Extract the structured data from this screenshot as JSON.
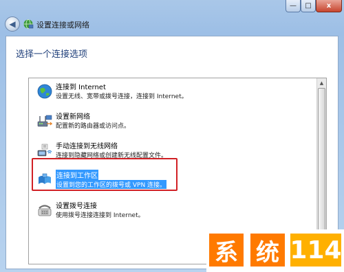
{
  "window": {
    "title": "设置连接或网络",
    "controls": {
      "minimize": "—",
      "maximize": "□",
      "close": "x"
    },
    "back_glyph": "◀"
  },
  "page": {
    "heading": "选择一个连接选项"
  },
  "options": [
    {
      "title": "连接到 Internet",
      "desc": "设置无线、宽带或拨号连接，连接到 Internet。",
      "icon": "globe-internet-icon",
      "selected": false
    },
    {
      "title": "设置新网络",
      "desc": "配置新的路由器或访问点。",
      "icon": "network-router-icon",
      "selected": false
    },
    {
      "title": "手动连接到无线网络",
      "desc": "连接到隐藏网络或创建新无线配置文件。",
      "icon": "wireless-network-icon",
      "selected": false
    },
    {
      "title": "连接到工作区",
      "desc": "设置到您的工作区的拨号或 VPN 连接。",
      "icon": "workplace-vpn-icon",
      "selected": true
    },
    {
      "title": "设置拨号连接",
      "desc": "使用拨号连接连接到 Internet。",
      "icon": "dialup-phone-icon",
      "selected": false
    }
  ],
  "watermark": {
    "part1": "系",
    "part2": "统",
    "part3": "114",
    "colors": {
      "orange": "#ff7a00",
      "yellow": "#ffb000"
    }
  },
  "colors": {
    "selection": "#3399ff",
    "annotation_box": "#d11f24",
    "heading": "#1f3f7a"
  }
}
